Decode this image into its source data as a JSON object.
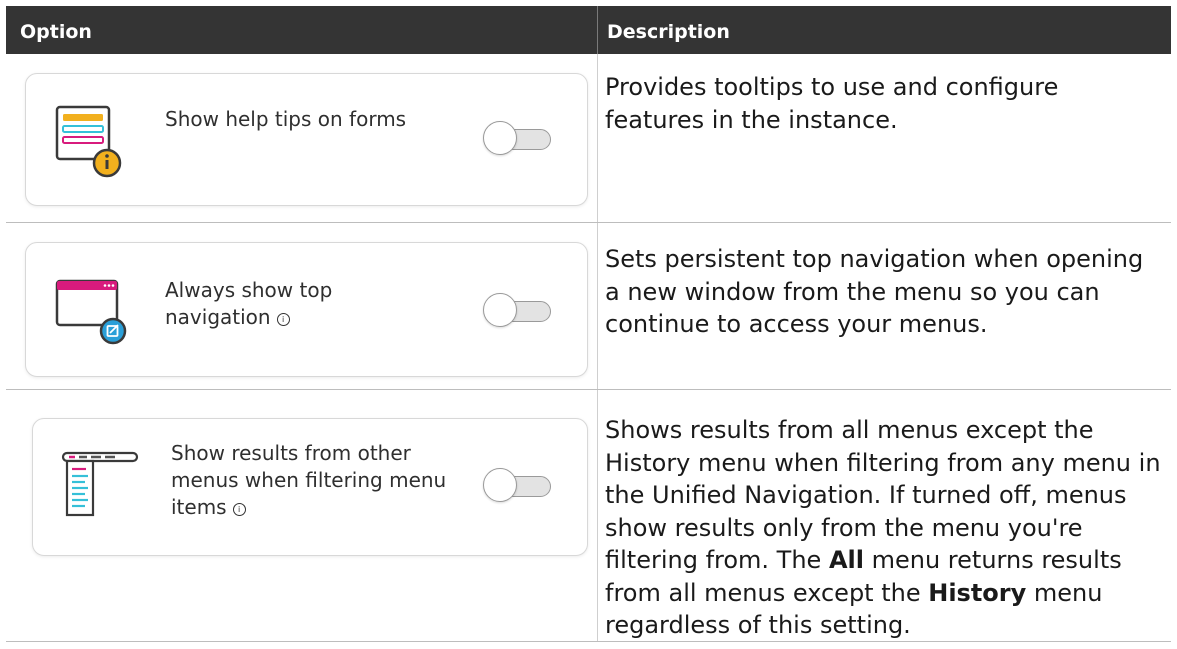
{
  "table": {
    "headers": {
      "option": "Option",
      "description": "Description"
    },
    "rows": [
      {
        "option_label": "Show help tips on forms",
        "option_info_icon": false,
        "toggle_state": "off",
        "icon": "form-help-icon",
        "description": "Provides tooltips to use and configure features in the instance."
      },
      {
        "option_label": "Always show top navigation",
        "option_info_icon": true,
        "toggle_state": "off",
        "icon": "window-navigation-icon",
        "description": "Sets persistent top navigation when opening a new window from the menu so you can continue to access your menus."
      },
      {
        "option_label": "Show results from other menus when filtering menu items",
        "option_info_icon": true,
        "toggle_state": "off",
        "icon": "menu-list-icon",
        "description_parts": {
          "p1": "Shows results from all menus except the History menu when filtering from any menu in the Unified Navigation. If turned off, menus show results only from the menu you're filtering from. The ",
          "b1": "All",
          "p2": " menu returns results from all menus except the ",
          "b2": "History",
          "p3": " menu regardless of this setting."
        }
      }
    ]
  },
  "colors": {
    "header_bg": "#343434",
    "header_text": "#ffffff",
    "accent_yellow": "#f2b01e",
    "accent_teal": "#35c0d8",
    "accent_magenta": "#d81b7d",
    "accent_blue": "#2a9fd8"
  }
}
